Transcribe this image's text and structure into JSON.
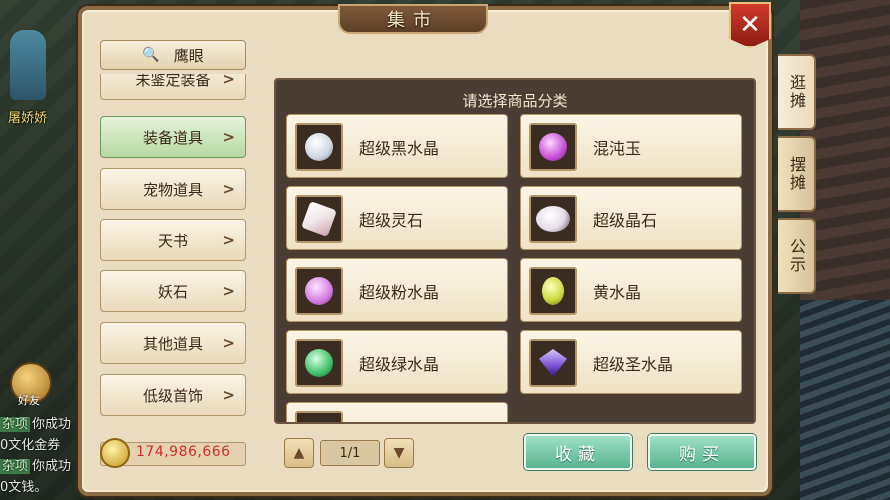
{
  "window": {
    "title": "集市",
    "close_label": "✕"
  },
  "background": {
    "npc_name": "屠娇娇",
    "friend_label": "好友",
    "chat": [
      {
        "tag": "杂项",
        "text": "你成功"
      },
      {
        "tag": "",
        "text": "0文化金券"
      },
      {
        "tag": "杂项",
        "text": "你成功"
      },
      {
        "tag": "",
        "text": "0文钱。"
      }
    ]
  },
  "left": {
    "search_label": "鹰眼",
    "categories": [
      {
        "label": "未鉴定装备",
        "active": false
      },
      {
        "label": "装备道具",
        "active": true
      },
      {
        "label": "宠物道具",
        "active": false
      },
      {
        "label": "天书",
        "active": false
      },
      {
        "label": "妖石",
        "active": false
      },
      {
        "label": "其他道具",
        "active": false
      },
      {
        "label": "低级首饰",
        "active": false
      }
    ],
    "money": "174,986,666"
  },
  "content": {
    "title": "请选择商品分类",
    "items": [
      {
        "name": "超级黑水晶",
        "color": "#cfd5e0"
      },
      {
        "name": "混沌玉",
        "color": "#c64fd6"
      },
      {
        "name": "超级灵石",
        "color": "#f0e6e8"
      },
      {
        "name": "超级晶石",
        "color": "#e4dde8"
      },
      {
        "name": "超级粉水晶",
        "color": "#d27be0"
      },
      {
        "name": "黄水晶",
        "color": "#c9d83c"
      },
      {
        "name": "超级绿水晶",
        "color": "#3fbf6a"
      },
      {
        "name": "超级圣水晶",
        "color": "#7a4fd6"
      }
    ]
  },
  "pager": {
    "up": "▲",
    "down": "▼",
    "text": "1/1"
  },
  "actions": {
    "favorite": "收藏",
    "buy": "购买"
  },
  "side_tabs": [
    {
      "label": "逛摊",
      "active": true
    },
    {
      "label": "摆摊",
      "active": false
    },
    {
      "label": "公示",
      "active": false
    }
  ]
}
